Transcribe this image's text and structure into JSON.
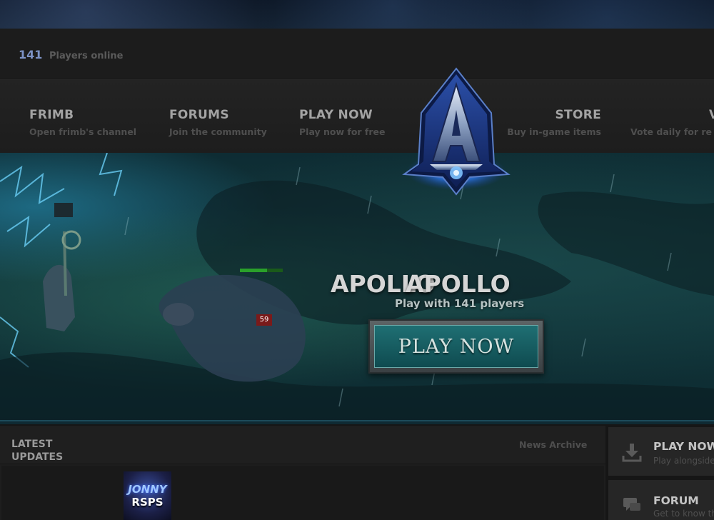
{
  "header": {
    "online_count": "141",
    "online_label": "Players online"
  },
  "nav": {
    "items": [
      {
        "title": "FRIMB",
        "subtitle": "Open frimb's channel"
      },
      {
        "title": "FORUMS",
        "subtitle": "Join the community"
      },
      {
        "title": "PLAY NOW",
        "subtitle": "Play now for free"
      },
      {
        "title": "STORE",
        "subtitle": "Buy in-game items"
      },
      {
        "title": "V",
        "subtitle": "Vote daily for re"
      }
    ],
    "logo_letter": "A"
  },
  "hero": {
    "title_a": "APOLLO",
    "title_b": "APOLLO",
    "subtitle": "Play with 141 players",
    "button_label": "PLAY NOW",
    "npc_number": "59"
  },
  "updates": {
    "title": "LATEST UPDATES",
    "archive_link": "News Archive",
    "thumb_line1": "JONNY",
    "thumb_line2": "RSPS"
  },
  "sidebar": {
    "cards": [
      {
        "title": "PLAY NOW",
        "subtitle": "Play alongside",
        "icon": "download-icon"
      },
      {
        "title": "FORUM",
        "subtitle": "Get to know th",
        "icon": "chat-icon"
      }
    ]
  },
  "colors": {
    "accent": "#7d93c6",
    "button_teal": "#1f6f73",
    "background": "#161616"
  }
}
